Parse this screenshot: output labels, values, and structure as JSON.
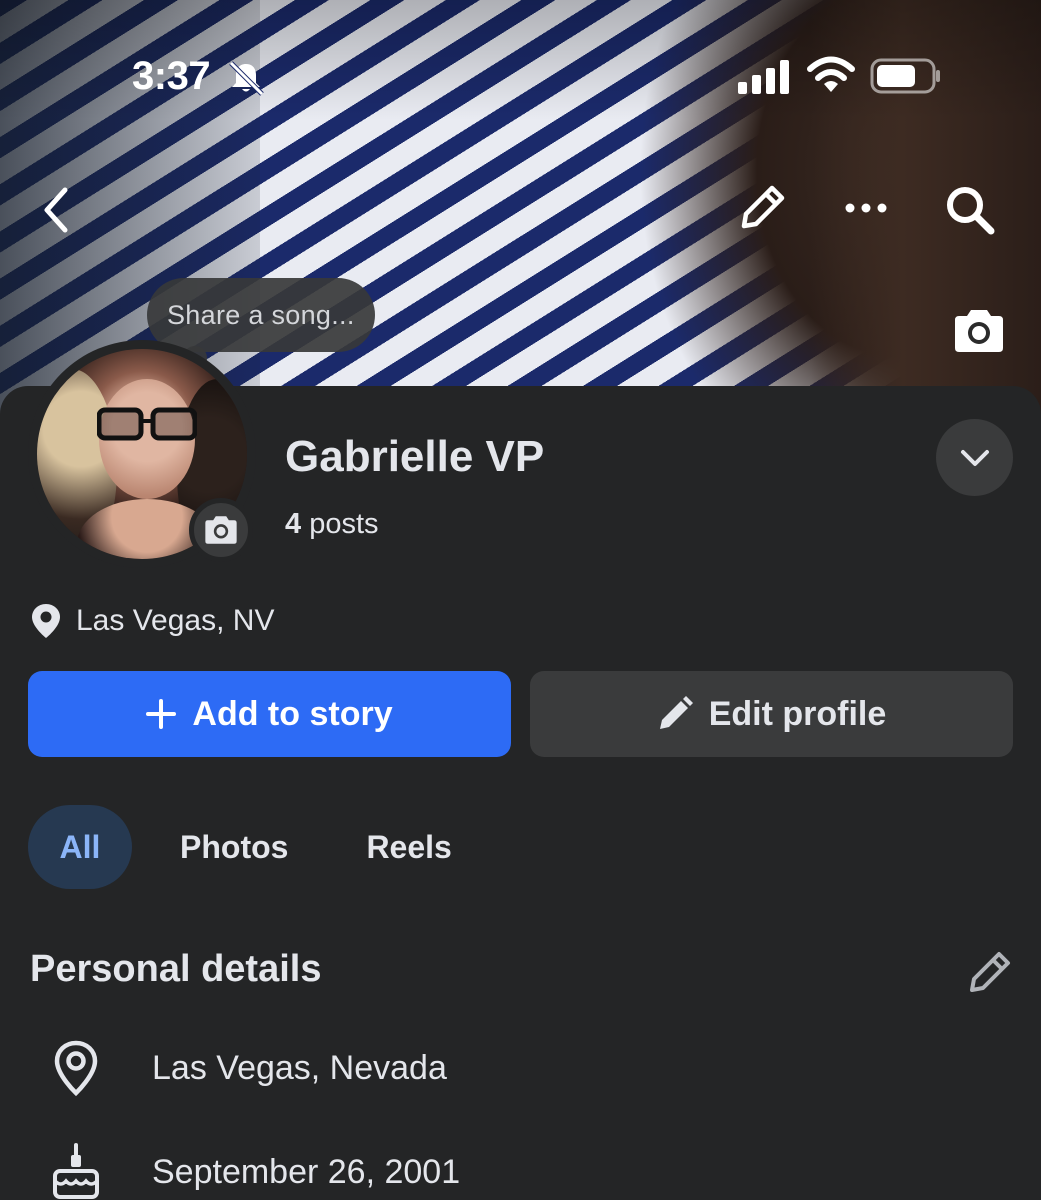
{
  "status_bar": {
    "time": "3:37"
  },
  "cover": {
    "song_prompt": "Share a song..."
  },
  "profile": {
    "name": "Gabrielle VP",
    "post_count": "4",
    "posts_label": "posts",
    "location": "Las Vegas, NV"
  },
  "actions": {
    "add_to_story": "Add to story",
    "edit_profile": "Edit profile"
  },
  "tabs": [
    {
      "label": "All",
      "selected": true
    },
    {
      "label": "Photos",
      "selected": false
    },
    {
      "label": "Reels",
      "selected": false
    }
  ],
  "personal_details": {
    "title": "Personal details",
    "items": [
      {
        "icon": "location-pin-icon",
        "text": "Las Vegas, Nevada"
      },
      {
        "icon": "birthday-cake-icon",
        "text": "September 26, 2001"
      }
    ]
  },
  "colors": {
    "background": "#242526",
    "primary_button": "#2d6bf5",
    "secondary_button": "#3a3b3c",
    "selected_tab_bg": "#263951",
    "selected_tab_text": "#8bb5f8"
  }
}
